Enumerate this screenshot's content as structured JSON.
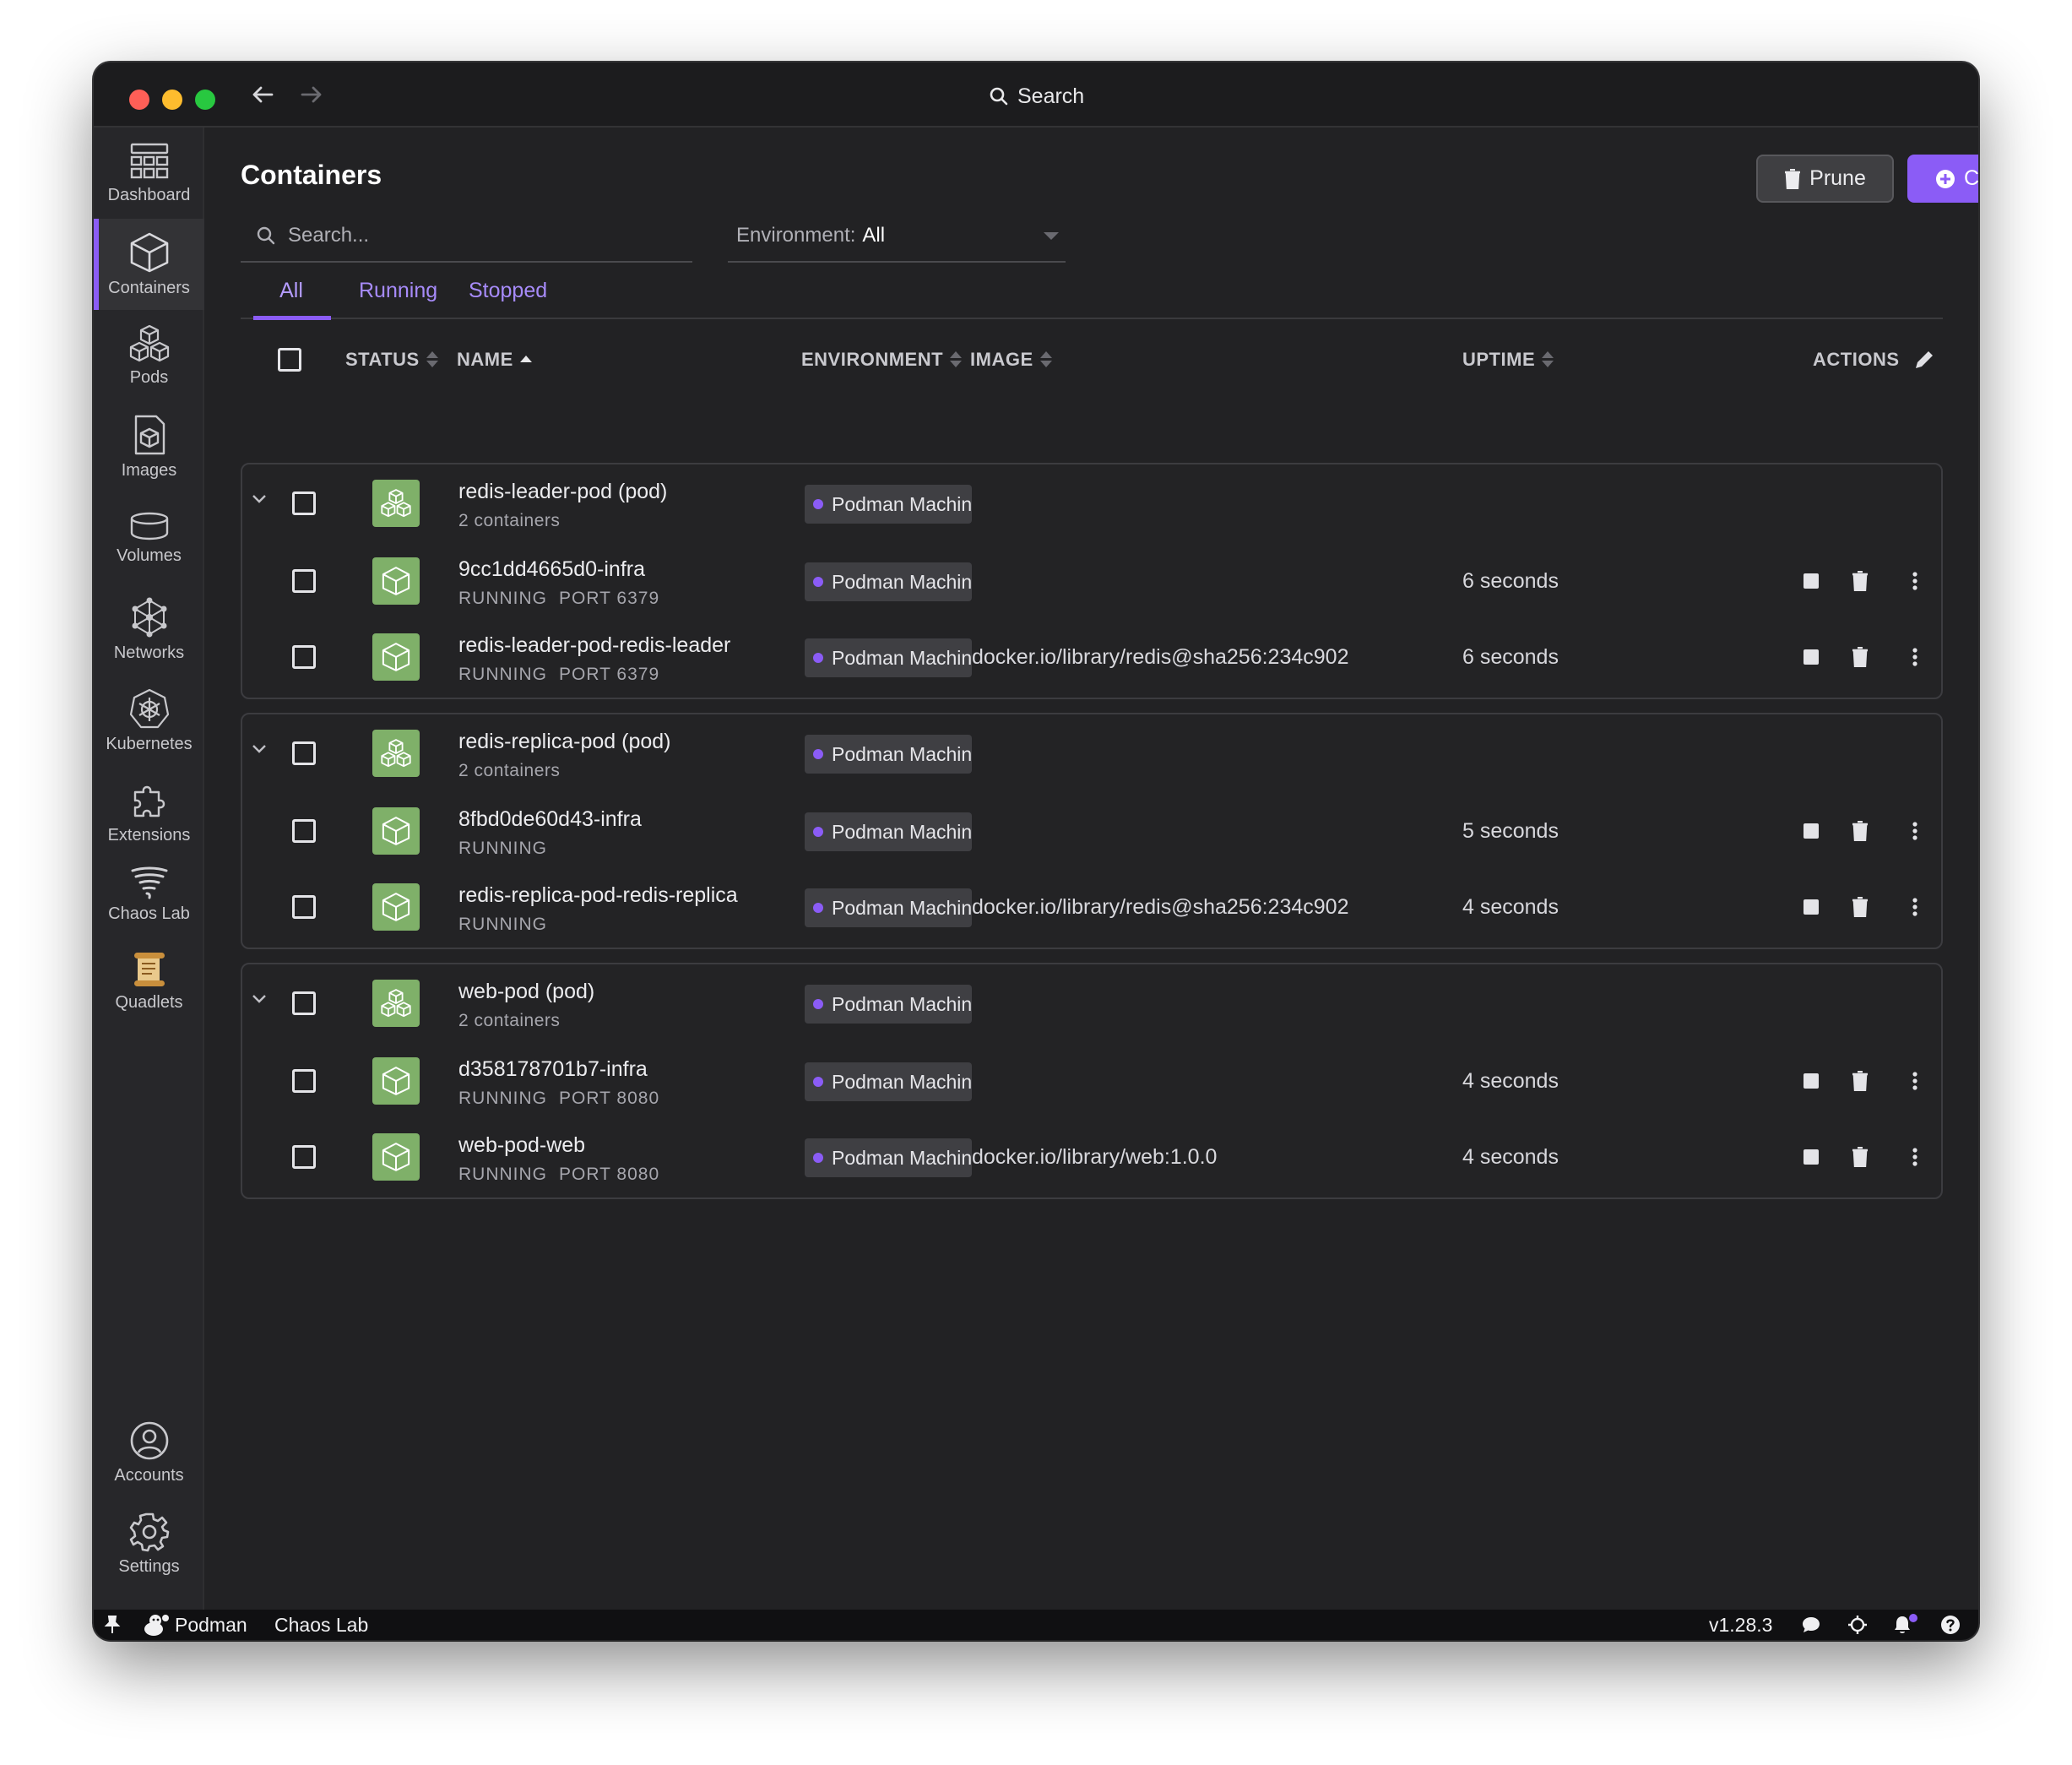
{
  "titlebar": {
    "search_label": "Search"
  },
  "sidebar": {
    "items": [
      {
        "label": "Dashboard"
      },
      {
        "label": "Containers"
      },
      {
        "label": "Pods"
      },
      {
        "label": "Images"
      },
      {
        "label": "Volumes"
      },
      {
        "label": "Networks"
      },
      {
        "label": "Kubernetes"
      },
      {
        "label": "Extensions"
      },
      {
        "label": "Chaos Lab"
      },
      {
        "label": "Quadlets"
      }
    ],
    "bottom": [
      {
        "label": "Accounts"
      },
      {
        "label": "Settings"
      }
    ]
  },
  "page": {
    "title": "Containers",
    "prune_label": "Prune",
    "create_label": "Create",
    "search_placeholder": "Search...",
    "environment_label": "Environment:",
    "environment_value": "All"
  },
  "tabs": [
    "All",
    "Running",
    "Stopped"
  ],
  "table": {
    "headers": {
      "status": "STATUS",
      "name": "NAME",
      "environment": "ENVIRONMENT",
      "image": "IMAGE",
      "uptime": "UPTIME",
      "actions": "ACTIONS"
    },
    "groups": [
      {
        "pod": {
          "name": "redis-leader-pod (pod)",
          "sub": "2 containers",
          "env": "Podman Machine"
        },
        "containers": [
          {
            "name": "9cc1dd4665d0-infra",
            "state": "RUNNING",
            "port": "PORT 6379",
            "env": "Podman Machine",
            "image": "",
            "uptime": "6 seconds"
          },
          {
            "name": "redis-leader-pod-redis-leader",
            "state": "RUNNING",
            "port": "PORT 6379",
            "env": "Podman Machine",
            "image": "docker.io/library/redis@sha256:234c902",
            "uptime": "6 seconds"
          }
        ]
      },
      {
        "pod": {
          "name": "redis-replica-pod (pod)",
          "sub": "2 containers",
          "env": "Podman Machine"
        },
        "containers": [
          {
            "name": "8fbd0de60d43-infra",
            "state": "RUNNING",
            "port": "",
            "env": "Podman Machine",
            "image": "",
            "uptime": "5 seconds"
          },
          {
            "name": "redis-replica-pod-redis-replica",
            "state": "RUNNING",
            "port": "",
            "env": "Podman Machine",
            "image": "docker.io/library/redis@sha256:234c902",
            "uptime": "4 seconds"
          }
        ]
      },
      {
        "pod": {
          "name": "web-pod (pod)",
          "sub": "2 containers",
          "env": "Podman Machine"
        },
        "containers": [
          {
            "name": "d358178701b7-infra",
            "state": "RUNNING",
            "port": "PORT 8080",
            "env": "Podman Machine",
            "image": "",
            "uptime": "4 seconds"
          },
          {
            "name": "web-pod-web",
            "state": "RUNNING",
            "port": "PORT 8080",
            "env": "Podman Machine",
            "image": "docker.io/library/web:1.0.0",
            "uptime": "4 seconds"
          }
        ]
      }
    ]
  },
  "statusbar": {
    "engine": "Podman",
    "extension": "Chaos Lab",
    "version": "v1.28.3"
  },
  "colors": {
    "accent": "#8b5cf6",
    "running_icon_bg": "#7fb069",
    "window_bg": "#222224",
    "sidebar_bg": "#27272a"
  }
}
